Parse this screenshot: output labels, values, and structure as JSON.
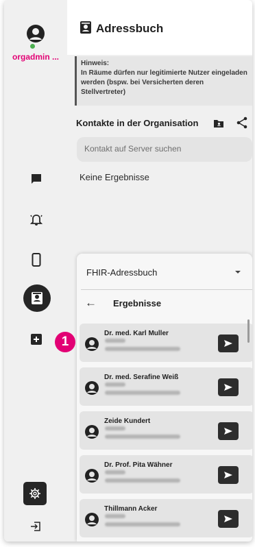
{
  "sidebar": {
    "user_name": "orgadmin ...",
    "icons": [
      "chat-icon",
      "bell-icon",
      "phone-icon",
      "addressbook-icon",
      "add-icon",
      "settings-icon",
      "logout-icon"
    ],
    "badge": "1"
  },
  "header": {
    "title": "Adressbuch",
    "icon": "addressbook-icon"
  },
  "notice": {
    "label": "Hinweis:",
    "text": "In Räume dürfen nur legitimierte Nutzer eingeladen werden (bspw. bei Versicherten deren Stellvertreter)"
  },
  "contacts": {
    "heading": "Kontakte in der Organisation",
    "search_placeholder": "Kontakt auf Server suchen",
    "empty_text": "Keine Ergebnisse"
  },
  "fhir": {
    "selected": "FHIR-Adressbuch",
    "results_heading": "Ergebnisse",
    "results": [
      {
        "name": "Dr. med. Karl Muller"
      },
      {
        "name": "Dr. med. Serafine Weiß"
      },
      {
        "name": "Zeide Kundert"
      },
      {
        "name": "Dr. Prof. Pita Wähner"
      },
      {
        "name": "Thillmann Acker"
      }
    ]
  },
  "colors": {
    "accent": "#e20074",
    "dark": "#262626",
    "online": "#4caf50"
  }
}
